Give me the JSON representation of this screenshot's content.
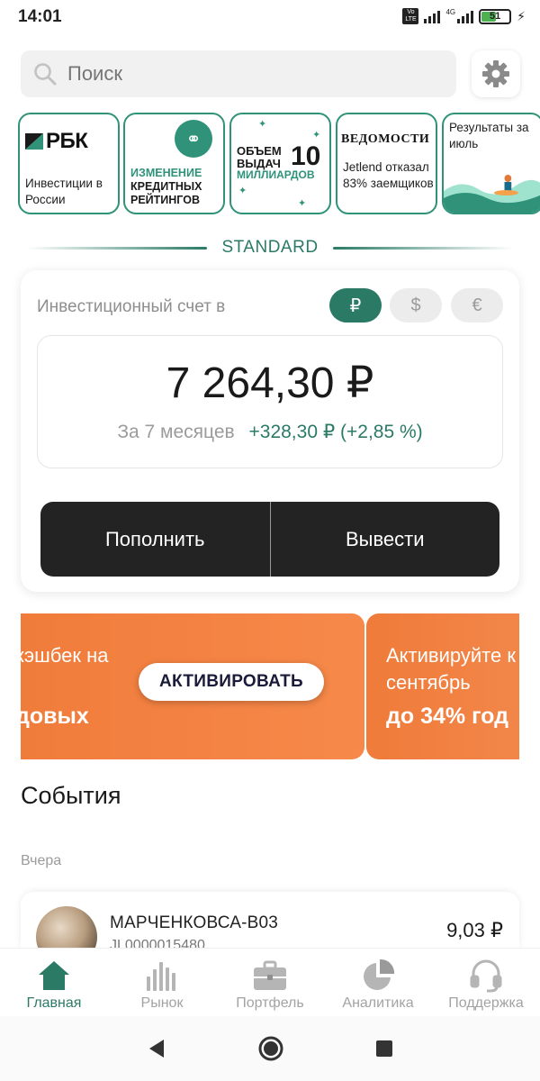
{
  "status_bar": {
    "time": "14:01",
    "volte": "Vo LTE",
    "network": "4G",
    "battery": "51"
  },
  "search": {
    "placeholder": "Поиск"
  },
  "stories": [
    {
      "brand": "РБК",
      "text": "Инвестиции в России"
    },
    {
      "line1": "ИЗМЕНЕНИЕ",
      "line2": "КРЕДИТНЫХ",
      "line3": "РЕЙТИНГОВ"
    },
    {
      "line1": "ОБЪЕМ",
      "line2": "ВЫДАЧ",
      "number": "10",
      "sub": "МИЛЛИАРДОВ"
    },
    {
      "brand": "ВЕДОМОСТИ",
      "text": "Jetlend отказал 83% заемщиков"
    },
    {
      "text": "Результаты за июль"
    }
  ],
  "section": {
    "title": "STANDARD"
  },
  "account": {
    "label": "Инвестиционный счет в",
    "currencies": [
      "₽",
      "$",
      "€"
    ],
    "active_currency": "₽",
    "balance": "7 264,30 ₽",
    "period": "За 7 месяцев",
    "change": "+328,30 ₽  (+2,85 %)",
    "deposit_label": "Пополнить",
    "withdraw_label": "Вывести"
  },
  "promo": {
    "card1": {
      "line1": "кэшбек на",
      "line2": "довых",
      "button": "АКТИВИРОВАТЬ"
    },
    "card2": {
      "line1": "Активируйте к",
      "line2": "сентябрь",
      "line3": "до 34% год"
    }
  },
  "events": {
    "title": "События",
    "date_group": "Вчера",
    "items": [
      {
        "name": "МАРЧЕНКОВСА-В03",
        "id": "JL0000015480",
        "amount": "9,03 ₽"
      }
    ]
  },
  "nav": {
    "items": [
      {
        "label": "Главная",
        "icon": "home-icon",
        "active": true
      },
      {
        "label": "Рынок",
        "icon": "market-bars-icon"
      },
      {
        "label": "Портфель",
        "icon": "briefcase-icon"
      },
      {
        "label": "Аналитика",
        "icon": "pie-chart-icon"
      },
      {
        "label": "Поддержка",
        "icon": "headset-icon"
      }
    ]
  },
  "colors": {
    "accent": "#2b7a66",
    "story_border": "#2f9279",
    "promo": "#f07b3a",
    "dark_button": "#232323"
  }
}
